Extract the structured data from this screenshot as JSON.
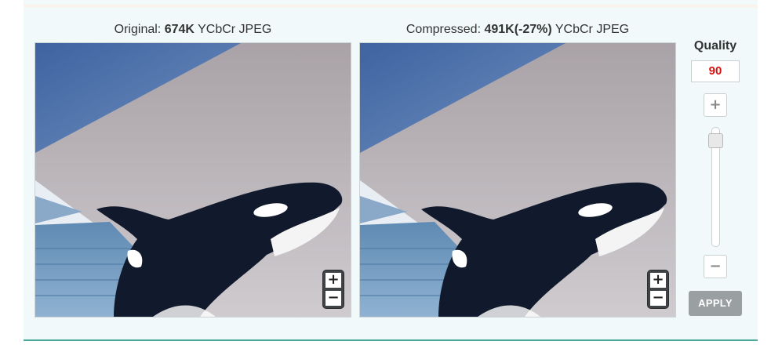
{
  "original": {
    "label": "Original: ",
    "size": "674K",
    "format": " YCbCr JPEG"
  },
  "compressed": {
    "label": "Compressed: ",
    "size": "491K(-27%)",
    "format": " YCbCr JPEG"
  },
  "zoom": {
    "plus": "+",
    "minus": "−"
  },
  "quality": {
    "label": "Quality",
    "value": "90",
    "plus": "+",
    "minus": "−",
    "apply": "APPLY",
    "slider_level_percent": 90
  },
  "colors": {
    "accent_rule": "#4aa79c",
    "quality_value": "#dd1111",
    "apply_bg": "#9a9fa2"
  }
}
